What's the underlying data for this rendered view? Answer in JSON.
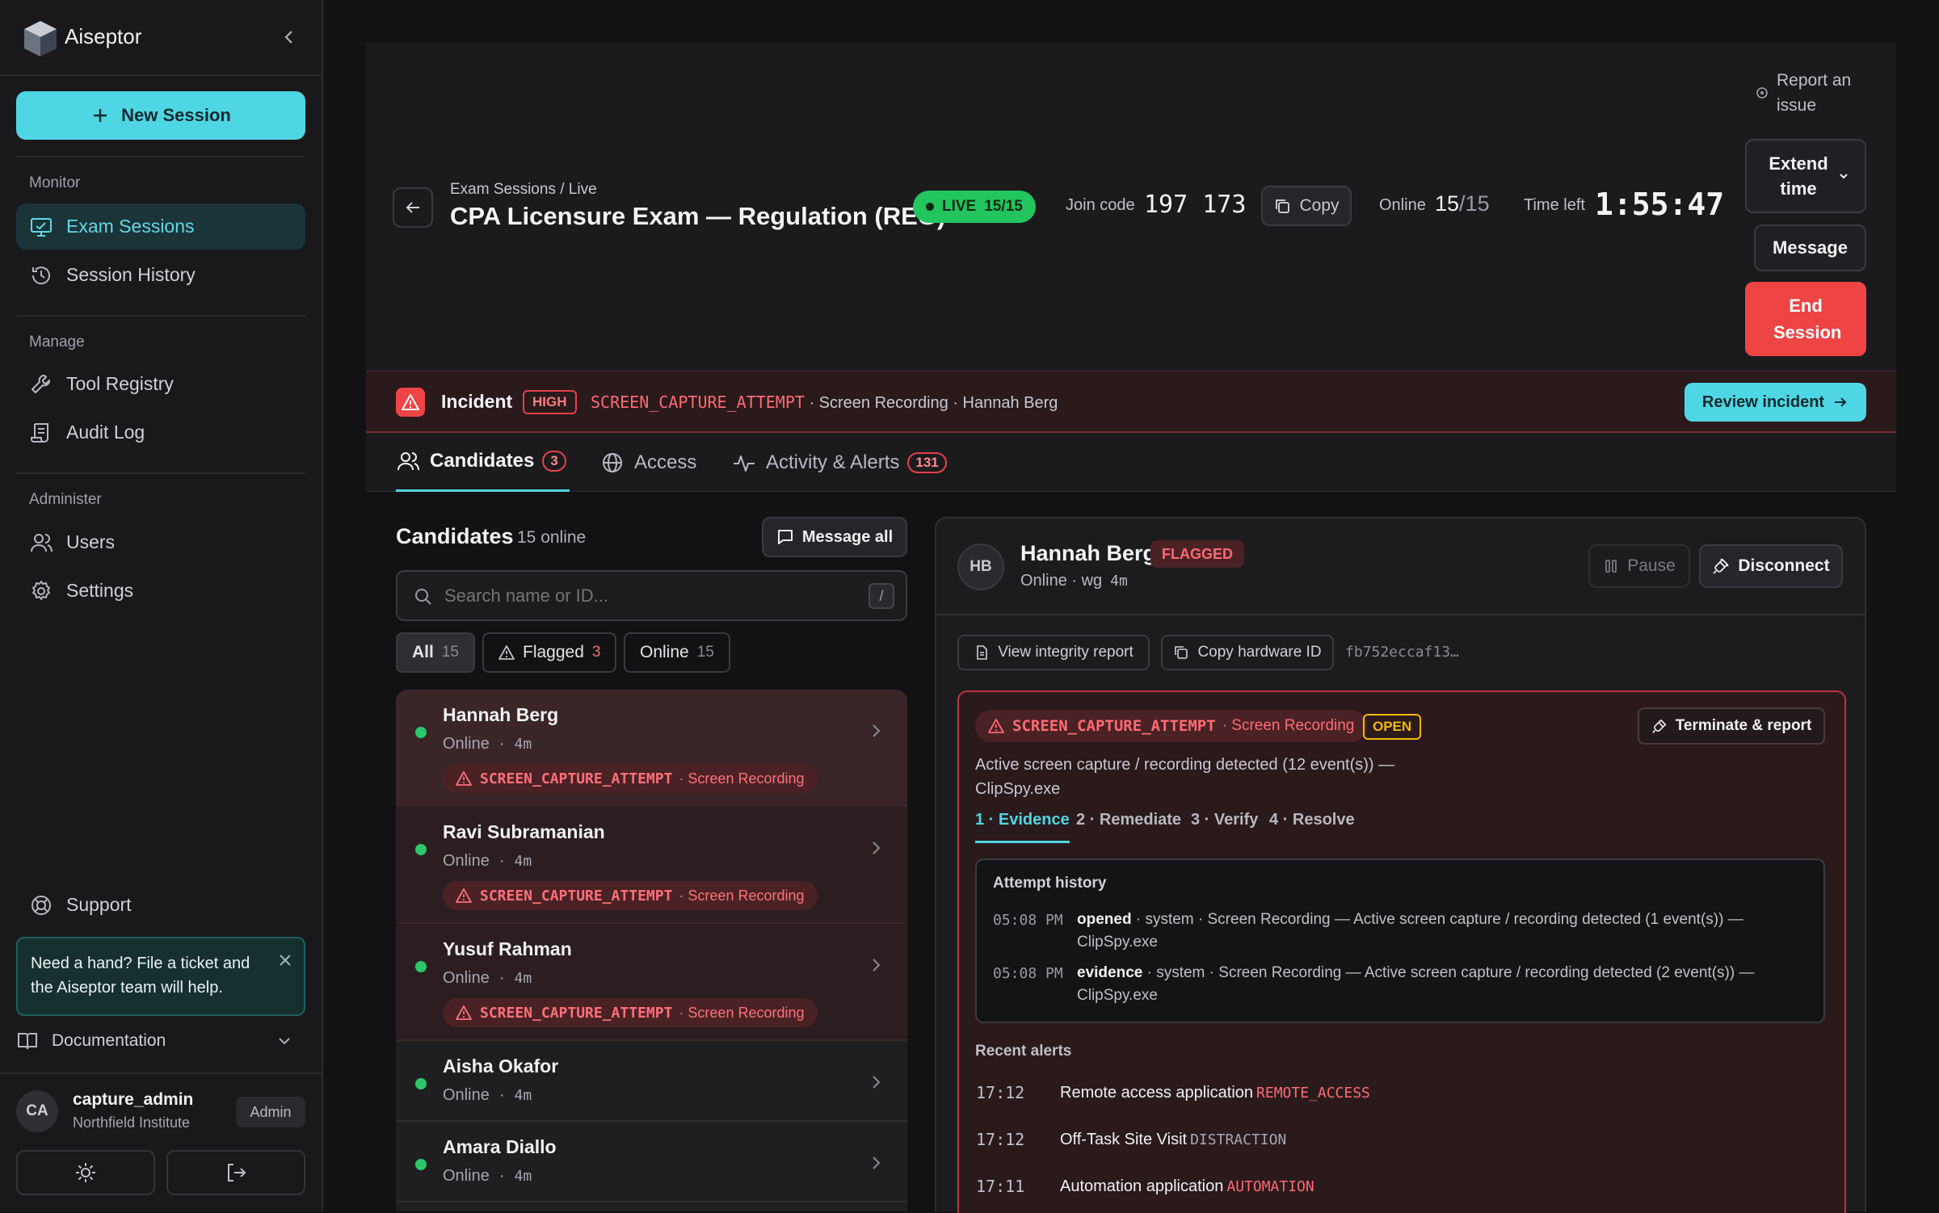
{
  "app": {
    "name": "Aiseptor"
  },
  "sidebar": {
    "new_session": "New Session",
    "sections": {
      "monitor": "Monitor",
      "manage": "Manage",
      "administer": "Administer"
    },
    "items": {
      "exam_sessions": "Exam Sessions",
      "session_history": "Session History",
      "tool_registry": "Tool Registry",
      "audit_log": "Audit Log",
      "users": "Users",
      "settings": "Settings",
      "support": "Support"
    },
    "help_text": "Need a hand? File a ticket and the Aiseptor team will help.",
    "documentation": "Documentation",
    "user": {
      "initials": "CA",
      "name": "capture_admin",
      "org": "Northfield Institute",
      "role": "Admin"
    }
  },
  "header": {
    "breadcrumb": "Exam Sessions / Live",
    "title": "CPA Licensure Exam — Regulation (REG)",
    "live_label": "LIVE",
    "live_count": "15/15",
    "join_code_label": "Join code",
    "join_code": "197 173",
    "copy": "Copy",
    "online_label": "Online",
    "online_value": "15",
    "online_total": "/15",
    "time_left_label": "Time left",
    "time_left": "1:55:47",
    "report_issue": "Report an issue",
    "extend_time": "Extend time",
    "message": "Message",
    "end_session": "End Session"
  },
  "incident": {
    "label": "Incident",
    "severity": "HIGH",
    "code": "SCREEN_CAPTURE_ATTEMPT",
    "detail": "· Screen Recording · Hannah Berg",
    "review": "Review incident"
  },
  "tabs": [
    {
      "label": "Candidates",
      "count": "3"
    },
    {
      "label": "Access",
      "count": ""
    },
    {
      "label": "Activity & Alerts",
      "count": "131"
    }
  ],
  "candidates_panel": {
    "title": "Candidates",
    "subtitle": "15 online",
    "message_all": "Message all",
    "search_placeholder": "Search name or ID...",
    "search_shortcut": "/",
    "filters": [
      {
        "label": "All",
        "count": "15"
      },
      {
        "label": "Flagged",
        "count": "3"
      },
      {
        "label": "Online",
        "count": "15"
      }
    ],
    "list": [
      {
        "name": "Hannah Berg",
        "status": "Online",
        "ago": "4m",
        "alert_code": "SCREEN_CAPTURE_ATTEMPT",
        "alert_type": "· Screen Recording"
      },
      {
        "name": "Ravi Subramanian",
        "status": "Online",
        "ago": "4m",
        "alert_code": "SCREEN_CAPTURE_ATTEMPT",
        "alert_type": "· Screen Recording"
      },
      {
        "name": "Yusuf Rahman",
        "status": "Online",
        "ago": "4m",
        "alert_code": "SCREEN_CAPTURE_ATTEMPT",
        "alert_type": "· Screen Recording"
      },
      {
        "name": "Aisha Okafor",
        "status": "Online",
        "ago": "4m"
      },
      {
        "name": "Amara Diallo",
        "status": "Online",
        "ago": "4m"
      }
    ]
  },
  "detail": {
    "initials": "HB",
    "name": "Hannah Berg",
    "flag": "FLAGGED",
    "status": "Online · wg",
    "ago": "4m",
    "pause": "Pause",
    "disconnect": "Disconnect",
    "view_report": "View integrity report",
    "copy_hw": "Copy hardware ID",
    "hw_id": "fb752eccaf13…",
    "case": {
      "code": "SCREEN_CAPTURE_ATTEMPT",
      "type": "· Screen Recording",
      "state": "OPEN",
      "terminate": "Terminate & report",
      "description": "Active screen capture / recording detected (12 event(s)) — ClipSpy.exe",
      "steps": [
        "1 · Evidence",
        "2 · Remediate",
        "3 · Verify",
        "4 · Resolve"
      ],
      "history_title": "Attempt history",
      "history": [
        {
          "time": "05:08 PM",
          "action": "opened",
          "text": "· system · Screen Recording — Active screen capture / recording detected (1 event(s)) — ClipSpy.exe"
        },
        {
          "time": "05:08 PM",
          "action": "evidence",
          "text": "· system · Screen Recording — Active screen capture / recording detected (2 event(s)) — ClipSpy.exe"
        }
      ],
      "recent_title": "Recent alerts",
      "recent": [
        {
          "time": "17:12",
          "label": "Remote access application",
          "code": "REMOTE_ACCESS"
        },
        {
          "time": "17:12",
          "label": "Off-Task Site Visit",
          "code": "DISTRACTION"
        },
        {
          "time": "17:11",
          "label": "Automation application",
          "code": "AUTOMATION"
        }
      ]
    }
  },
  "colors": {
    "accent": "#4fd6e4",
    "danger": "#ef4444",
    "live": "#22c55e",
    "warning": "#f5b800"
  }
}
